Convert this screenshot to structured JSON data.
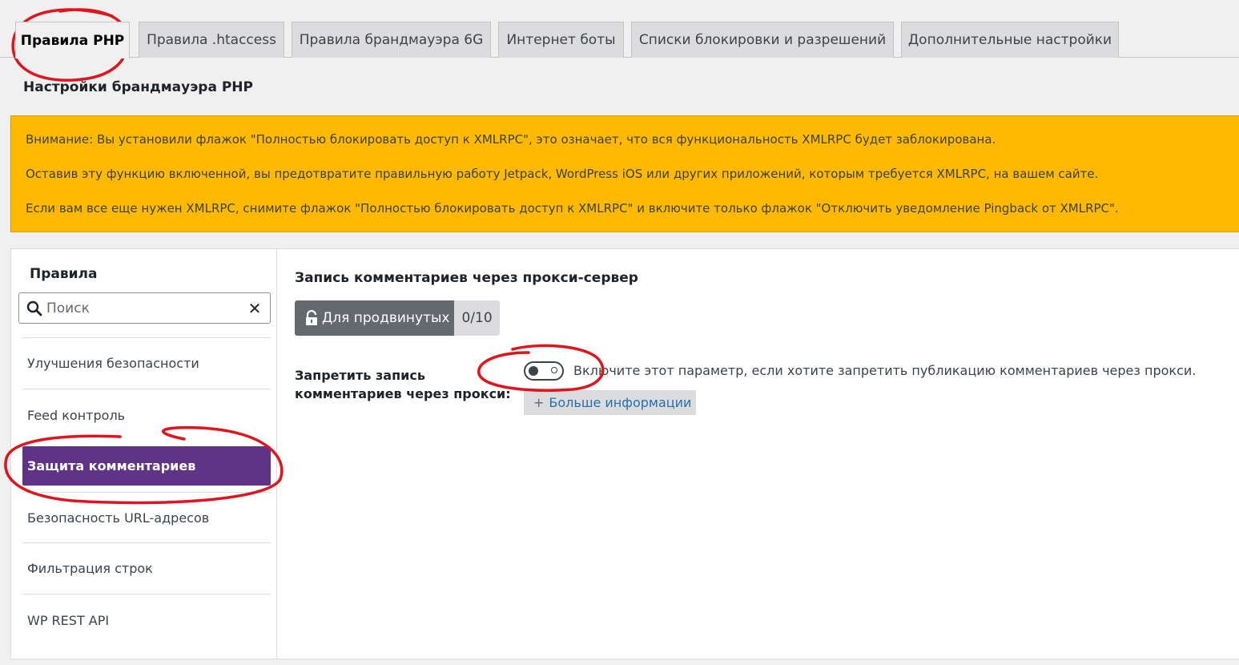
{
  "tabs": [
    {
      "label": "Правила PHP",
      "active": true
    },
    {
      "label": "Правила .htaccess"
    },
    {
      "label": "Правила брандмауэра 6G"
    },
    {
      "label": "Интернет боты"
    },
    {
      "label": "Списки блокировки и разрешений"
    },
    {
      "label": "Дополнительные настройки"
    }
  ],
  "page_heading": "Настройки брандмауэра PHP",
  "notice": {
    "color": "#ffb900",
    "lines": [
      "Внимание: Вы установили флажок \"Полностью блокировать доступ к XMLRPC\", это означает, что вся функциональность XMLRPC будет заблокирована.",
      "Оставив эту функцию включенной, вы предотвратите правильную работу Jetpack, WordPress iOS или других приложений, которым требуется XMLRPC, на вашем сайте.",
      "Если вам все еще нужен XMLRPC, снимите флажок \"Полностью блокировать доступ к XMLRPC\" и включите только флажок \"Отключить уведомление Pingback от XMLRPC\"."
    ]
  },
  "sidebar": {
    "title": "Правила",
    "search": {
      "placeholder": "Поиск",
      "value": ""
    },
    "items": [
      {
        "label": "Улучшения безопасности"
      },
      {
        "label": "Feed контроль"
      },
      {
        "label": "Защита комментариев",
        "active": true
      },
      {
        "label": "Безопасность URL-адресов"
      },
      {
        "label": "Фильтрация строк"
      },
      {
        "label": "WP REST API"
      }
    ],
    "active_color": "#5f3487"
  },
  "content": {
    "section_title": "Запись комментариев через прокси-сервер",
    "badge": {
      "label": "Для продвинутых",
      "count": "0/10",
      "icon": "unlock-icon"
    },
    "setting": {
      "label": "Запретить запись комментариев через прокси:",
      "enabled": false,
      "description": "Включите этот параметр, если хотите запретить публикацию комментариев через прокси.",
      "more_info": "Больше информации"
    }
  },
  "annotation_color": "#e0141c"
}
